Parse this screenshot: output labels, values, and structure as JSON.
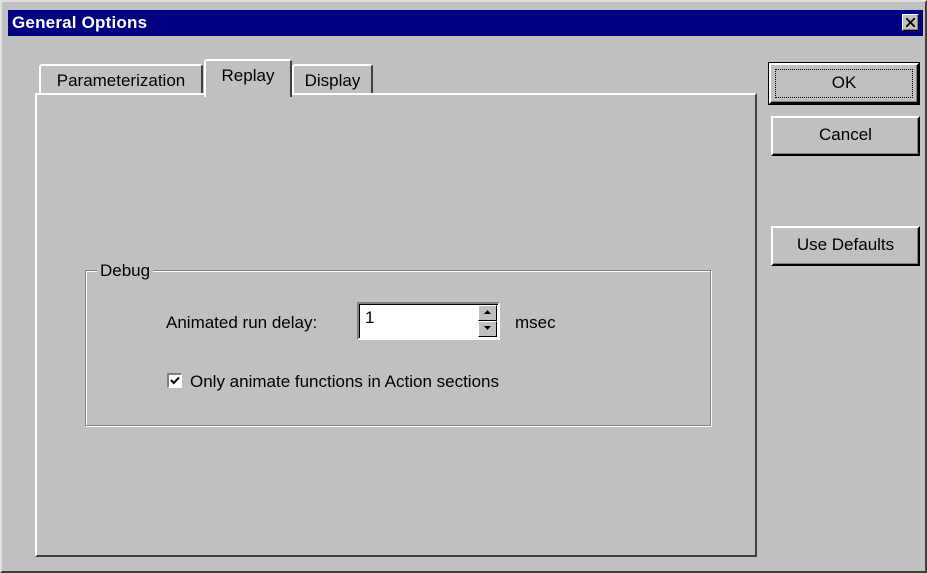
{
  "window": {
    "title": "General Options"
  },
  "tabs": [
    {
      "label": "Parameterization",
      "active": false
    },
    {
      "label": "Replay",
      "active": true
    },
    {
      "label": "Display",
      "active": false
    }
  ],
  "buttons": {
    "ok": "OK",
    "cancel": "Cancel",
    "use_defaults": "Use Defaults"
  },
  "debug_group": {
    "legend": "Debug",
    "delay_label": "Animated run delay:",
    "delay_value": "1",
    "delay_unit": "msec",
    "checkbox_label": "Only animate functions in Action sections",
    "checkbox_checked": true
  },
  "icons": {
    "close": "close-icon",
    "spin_up": "arrow-up-icon",
    "spin_down": "arrow-down-icon",
    "check": "checkmark-icon"
  },
  "colors": {
    "titlebar": "#000080",
    "face": "#c0c0c0"
  }
}
